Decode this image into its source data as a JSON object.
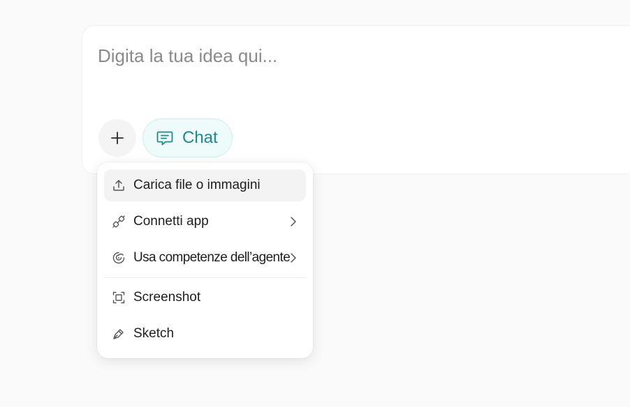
{
  "composer": {
    "placeholder": "Digita la tua idea qui...",
    "mode_chip": {
      "label": "Chat",
      "icon": "chat-bubble-icon",
      "color": "#1f8a8c"
    },
    "add_button_icon": "plus-icon"
  },
  "menu": {
    "items": [
      {
        "label": "Carica file o immagini",
        "icon": "upload-icon",
        "submenu": false,
        "highlighted": true
      },
      {
        "label": "Connetti app",
        "icon": "plug-connect-icon",
        "submenu": true,
        "highlighted": false
      },
      {
        "label": "Usa competenze dell’agente",
        "icon": "brain-icon",
        "submenu": true,
        "highlighted": false
      },
      {
        "label": "Screenshot",
        "icon": "screenshot-frame-icon",
        "submenu": false,
        "highlighted": false
      },
      {
        "label": "Sketch",
        "icon": "pen-icon",
        "submenu": false,
        "highlighted": false
      }
    ]
  }
}
